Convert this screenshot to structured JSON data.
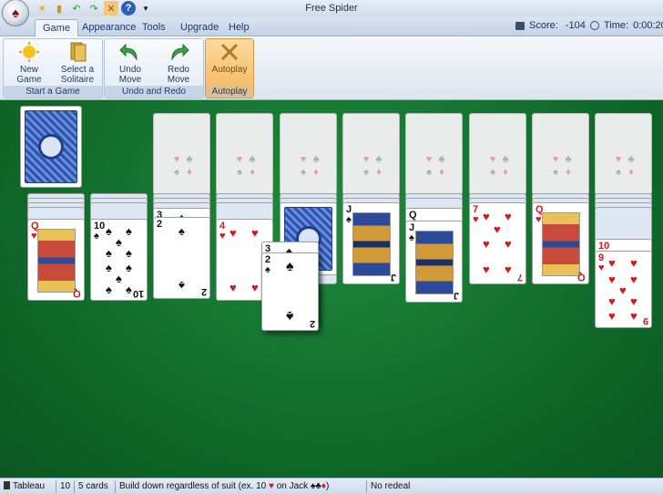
{
  "window": {
    "title": "Free Spider"
  },
  "menu": {
    "tabs": [
      "Game",
      "Appearance",
      "Tools",
      "Upgrade",
      "Help"
    ],
    "score_label": "Score:",
    "score_value": "-104",
    "time_label": "Time:",
    "time_value": "0:00:20"
  },
  "ribbon": {
    "new_game": "New\nGame",
    "select_solitaire": "Select a\nSolitaire",
    "group_start": "Start a Game",
    "undo_move": "Undo\nMove",
    "redo_move": "Redo\nMove",
    "group_undo": "Undo and Redo",
    "autoplay": "Autoplay",
    "group_autoplay": "Autoplay"
  },
  "tableau": {
    "columns": [
      {
        "face_down": 4,
        "face_up": [
          "Q♥"
        ]
      },
      {
        "face_down": 3,
        "face_up": [
          "10♠"
        ]
      },
      {
        "face_down": 3,
        "face_up": [
          "3♠",
          "2♠"
        ]
      },
      {
        "face_down": 3,
        "face_up": [
          "4♥"
        ]
      },
      {
        "face_down": 4,
        "face_up": []
      },
      {
        "face_down": 2,
        "face_up": [
          "J♠"
        ]
      },
      {
        "face_down": 2,
        "face_up": [
          "Q♠",
          "J♠"
        ]
      },
      {
        "face_down": 2,
        "face_up": [
          "7♥"
        ]
      },
      {
        "face_down": 2,
        "face_up": [
          "Q♥"
        ]
      },
      {
        "face_down": 4,
        "face_up": [
          "10♥",
          "9♥"
        ]
      }
    ],
    "dragged": [
      "3♠",
      "2♠"
    ]
  },
  "statusbar": {
    "game": "Tableau",
    "count": "10",
    "cards": "5 cards",
    "hint_pre": "Build down regardless of suit (ex. 10",
    "hint_mid": "on Jack",
    "hint_post": ")",
    "redeal": "No redeal"
  }
}
